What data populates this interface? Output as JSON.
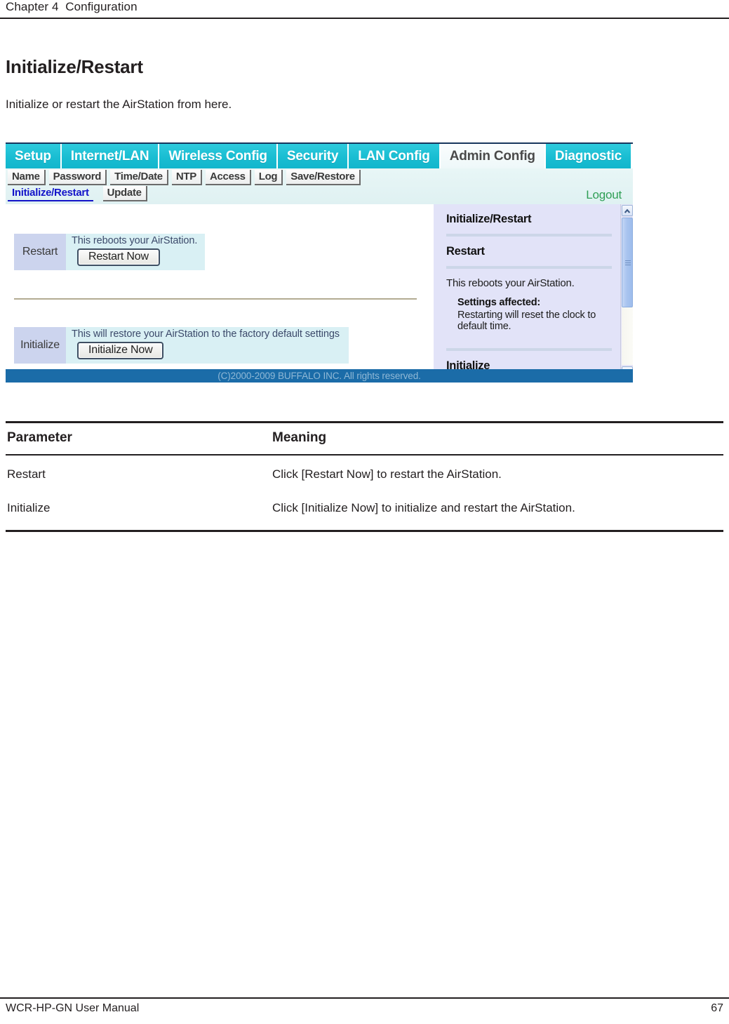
{
  "page": {
    "header": "Chapter 4  Configuration",
    "footer_left": "WCR-HP-GN User Manual",
    "footer_right": "67",
    "section_title": "Initialize/Restart",
    "section_intro": "Initialize or restart the AirStation from here."
  },
  "screenshot": {
    "tabs": [
      {
        "label": "Setup",
        "active": false
      },
      {
        "label": "Internet/LAN",
        "active": false
      },
      {
        "label": "Wireless Config",
        "active": false
      },
      {
        "label": "Security",
        "active": false
      },
      {
        "label": "LAN Config",
        "active": false
      },
      {
        "label": "Admin Config",
        "active": true
      },
      {
        "label": "Diagnostic",
        "active": false
      }
    ],
    "subtabs_row1": [
      {
        "label": "Name"
      },
      {
        "label": "Password"
      },
      {
        "label": "Time/Date"
      },
      {
        "label": "NTP"
      },
      {
        "label": "Access"
      },
      {
        "label": "Log"
      },
      {
        "label": "Save/Restore"
      }
    ],
    "subtabs_row2": [
      {
        "label": "Initialize/Restart",
        "current": true
      },
      {
        "label": "Update",
        "current": false
      }
    ],
    "logout_label": "Logout",
    "rows": [
      {
        "label": "Restart",
        "description": "This reboots your AirStation.",
        "button": "Restart Now"
      },
      {
        "label": "Initialize",
        "description": "This will restore your AirStation to the factory default settings",
        "button": "Initialize Now"
      }
    ],
    "help": {
      "title": "Initialize/Restart",
      "heading": "Restart",
      "paragraph": "This reboots your AirStation.",
      "affected_heading": "Settings affected:",
      "affected_body": "Restarting will reset the clock to default time.",
      "next_heading_partial": "Initialize"
    },
    "scrollbar": {
      "up_icon": "chevron-up-icon",
      "down_icon": "chevron-down-icon"
    },
    "copyright": "(C)2000-2009 BUFFALO INC. All rights reserved.",
    "colors": {
      "tab_cyan": "#19bdd2",
      "tab_active_bg": "#eef8f9",
      "label_cell": "#ccd4ee",
      "value_cell": "#d9f0f4",
      "help_bg": "#e2e3f8",
      "footer_blue": "#1b6ca8",
      "link_blue": "#1313c9",
      "logout_green": "#2f9f55"
    }
  },
  "table": {
    "headers": [
      "Parameter",
      "Meaning"
    ],
    "rows": [
      {
        "parameter": "Restart",
        "meaning": "Click [Restart Now] to restart the AirStation."
      },
      {
        "parameter": "Initialize",
        "meaning": "Click [Initialize Now] to initialize and restart the AirStation."
      }
    ]
  }
}
